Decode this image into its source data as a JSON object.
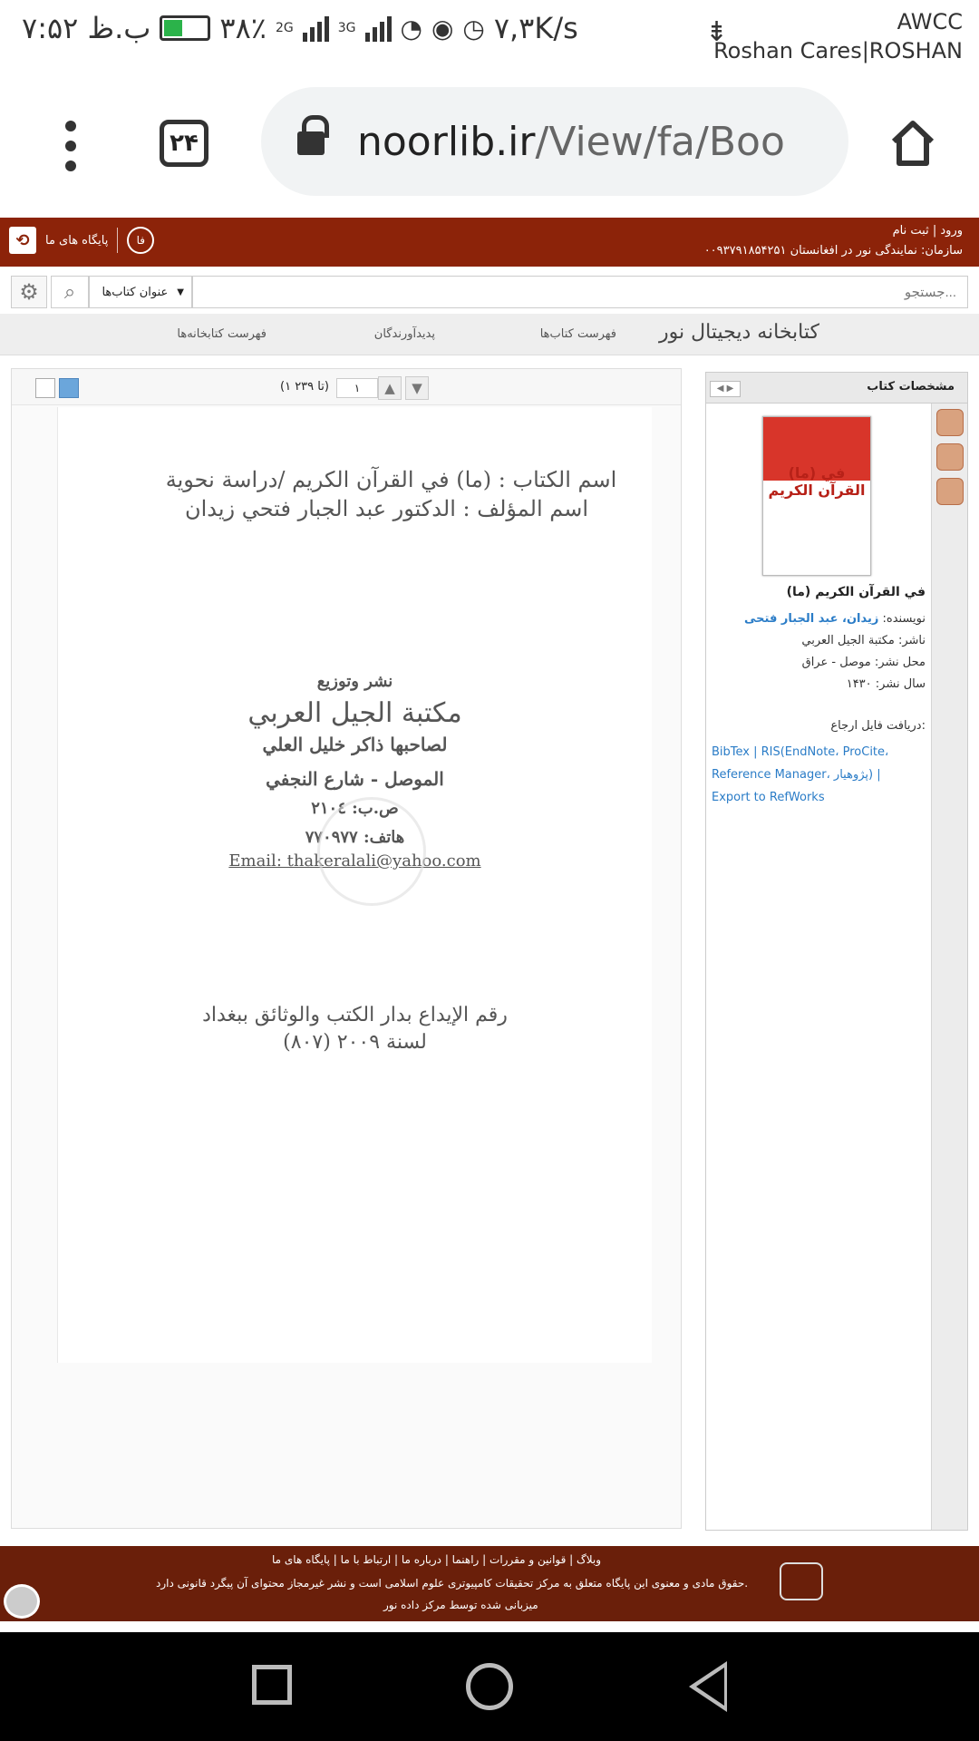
{
  "status": {
    "time": "۷:۵۲ ب.ظ",
    "battery": "۳۸٪",
    "network_a": "2G",
    "network_b": "3G",
    "speed": "۷,۳K/s",
    "operator_1": "AWCC",
    "operator_2": "Roshan Cares|ROSHAN"
  },
  "browser": {
    "tab_count": "۲۴",
    "url_host": "noorlib.ir",
    "url_path": "/View/fa/Boo"
  },
  "site": {
    "login": "ورود",
    "register": "ثبت نام",
    "separator": "|",
    "org": "سازمان: نمایندگی نور در افغانستان ۰۰۹۳۷۹۱۸۵۴۲۵۱",
    "lang": "فا",
    "bases": "پایگاه های ما",
    "search_placeholder": "جستجو...",
    "filter": "عنوان کتاب‌ها",
    "nav": [
      "فهرست کتاب‌ها",
      "پدیدآورندگان",
      "فهرست کتابخانه‌ها"
    ],
    "brand": "کتابخانه دیجیتال نور"
  },
  "viewer": {
    "page_number": "۱",
    "page_range": "(۱ تا ۲۳۹)",
    "scan": [
      "اسم الكتاب : (ما) في القرآن الكريم /دراسة نحوية",
      "اسم المؤلف : الدكتور عبد الجبار فتحي زيدان",
      "نشر وتوزيع",
      "مكتبة الجيل العربي",
      "لصاحبها ذاكر خليل العلي",
      "الموصل - شارع النجفي",
      "ص.ب: ٢١٠٤",
      "هاتف: ٧٧٠٩٧٧",
      "Email: thakeralali@yahoo.com",
      "رقم الإيداع بدار الكتب والوثائق ببغداد",
      "(٨٠٧) لسنة ٢٠٠٩"
    ]
  },
  "book": {
    "panel_title": "مشخصات کتاب",
    "cover_text": "(ما) في القرآن الكريم",
    "title": "(ما) في القرآن الكريم",
    "author_label": "نویسنده: ",
    "author": "زیدان، عبد الجبار فتحی",
    "publisher": "ناشر: مكتبة الجيل العربي",
    "place": "محل نشر: موصل - عراق",
    "year": "سال نشر: ۱۴۳۰",
    "citation_label": "دریافت فایل ارجاع:",
    "citation_links": "BibTex | RIS(EndNote، ProCite، Reference Manager، پژوهیار) | Export to RefWorks"
  },
  "footer": {
    "links": "وبلاگ | قوانین و مقررات | راهنما | درباره ما | ارتباط با ما | پایگاه های ما",
    "rights": "حقوق مادی و معنوی این پایگاه متعلق به مرکز تحقیقات کامپیوتری علوم اسلامی است و نشر غیرمجاز محتوای آن پیگرد قانونی دارد.",
    "hosted": "میزبانی شده توسط مرکز داده نور"
  },
  "colors": {
    "brand": "#8c2309",
    "footer": "#6a1f0a",
    "link": "#2a7cc7"
  }
}
